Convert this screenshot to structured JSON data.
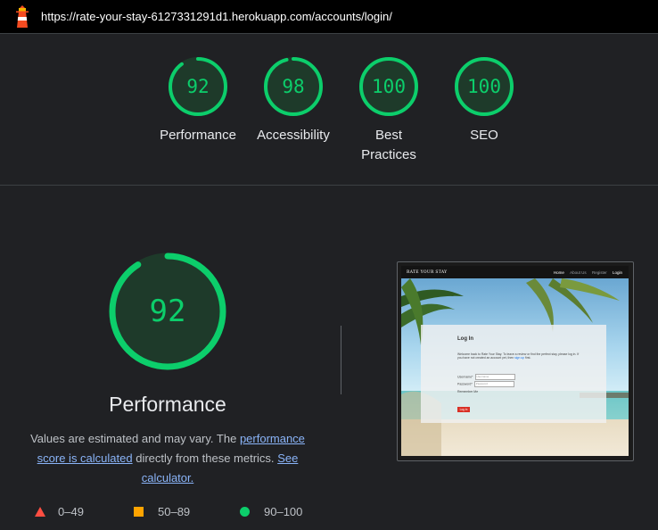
{
  "header": {
    "logo_icon": "lighthouse-icon",
    "url": "https://rate-your-stay-6127331291d1.herokuapp.com/accounts/login/"
  },
  "scores": [
    {
      "label": "Performance",
      "value": "92",
      "fraction": 0.92
    },
    {
      "label": "Accessibility",
      "value": "98",
      "fraction": 0.98
    },
    {
      "label": "Best Practices",
      "value": "100",
      "fraction": 1.0
    },
    {
      "label": "SEO",
      "value": "100",
      "fraction": 1.0
    }
  ],
  "detail": {
    "title": "Performance",
    "score": "92",
    "fraction": 0.92,
    "desc_prefix": "Values are estimated and may vary. The",
    "desc_link1": "performance score is calculated",
    "desc_middle": "directly from these metrics.",
    "desc_link2": "See calculator."
  },
  "legend": {
    "fail": "0–49",
    "average": "50–89",
    "pass": "90–100"
  },
  "screenshot": {
    "brand": "RATE YOUR STAY",
    "nav": [
      "Home",
      "About Us",
      "Register",
      "Login"
    ],
    "heading": "Log In",
    "intro": "Welcome back to Rate Your Stay. To leave a review or find the perfect stay, please log in. If you have not created an account yet, then",
    "intro_link": "sign up",
    "intro_end": "first.",
    "username_label": "Username*",
    "username_placeholder": "Username",
    "password_label": "Password*",
    "password_placeholder": "Password",
    "remember": "Remember Me",
    "button": "Log In"
  },
  "colors": {
    "pass": "#0cce6b",
    "average": "#ffa400",
    "fail": "#ff4e42",
    "link": "#8ab4f8",
    "background": "#202124"
  }
}
